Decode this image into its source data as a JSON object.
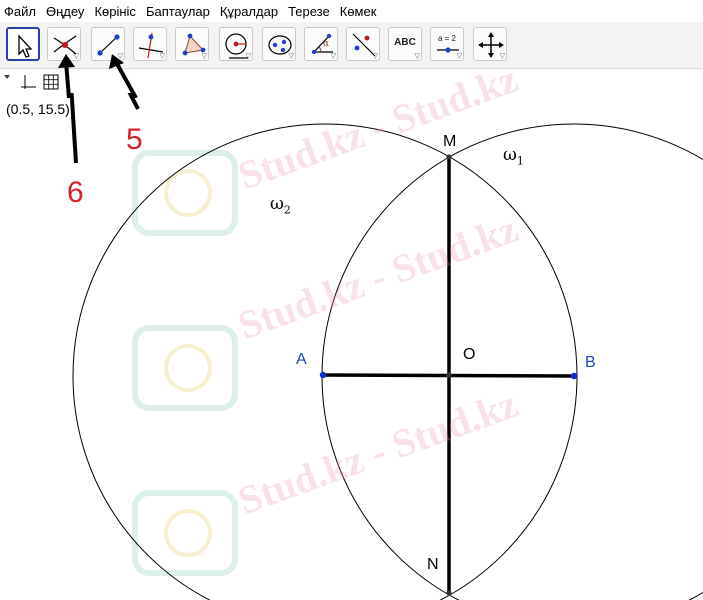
{
  "menu": [
    "Файл",
    "Өңдеу",
    "Көрініс",
    "Баптаулар",
    "Құралдар",
    "Терезе",
    "Көмек"
  ],
  "toolbar": {
    "tools": [
      {
        "name": "move-tool",
        "icon": "arrow-cursor-icon"
      },
      {
        "name": "intersect-tool",
        "icon": "intersect-icon"
      },
      {
        "name": "segment-tool",
        "icon": "segment-icon"
      },
      {
        "name": "perpendicular-line-tool",
        "icon": "perpendicular-icon"
      },
      {
        "name": "polygon-tool",
        "icon": "polygon-icon"
      },
      {
        "name": "circle-center-point-tool",
        "icon": "circle-icon"
      },
      {
        "name": "ellipse-tool",
        "icon": "ellipse-icon"
      },
      {
        "name": "angle-tool",
        "icon": "angle-icon"
      },
      {
        "name": "reflect-tool",
        "icon": "reflect-icon"
      },
      {
        "name": "text-tool",
        "icon": "text-icon",
        "label": "ABC"
      },
      {
        "name": "slider-tool",
        "icon": "slider-icon",
        "label": "a = 2"
      },
      {
        "name": "move-graphics-tool",
        "icon": "move-arrows-icon"
      }
    ]
  },
  "coordinate_readout": "(0.5, 15.5)",
  "points": {
    "M": "M",
    "N": "N",
    "A": "A",
    "B": "B",
    "O": "O"
  },
  "circles": {
    "omega1": "ω",
    "omega1_sub": "1",
    "omega2": "ω",
    "omega2_sub": "2"
  },
  "annotations": {
    "five": "5",
    "six": "6"
  },
  "watermark": "Stud.kz - Stud.kz",
  "colors": {
    "point_blue": "#0a2bd6",
    "label_blue": "#1f3fcf",
    "annotation_red": "#d8202a",
    "selected_border": "#2b3fa8"
  }
}
